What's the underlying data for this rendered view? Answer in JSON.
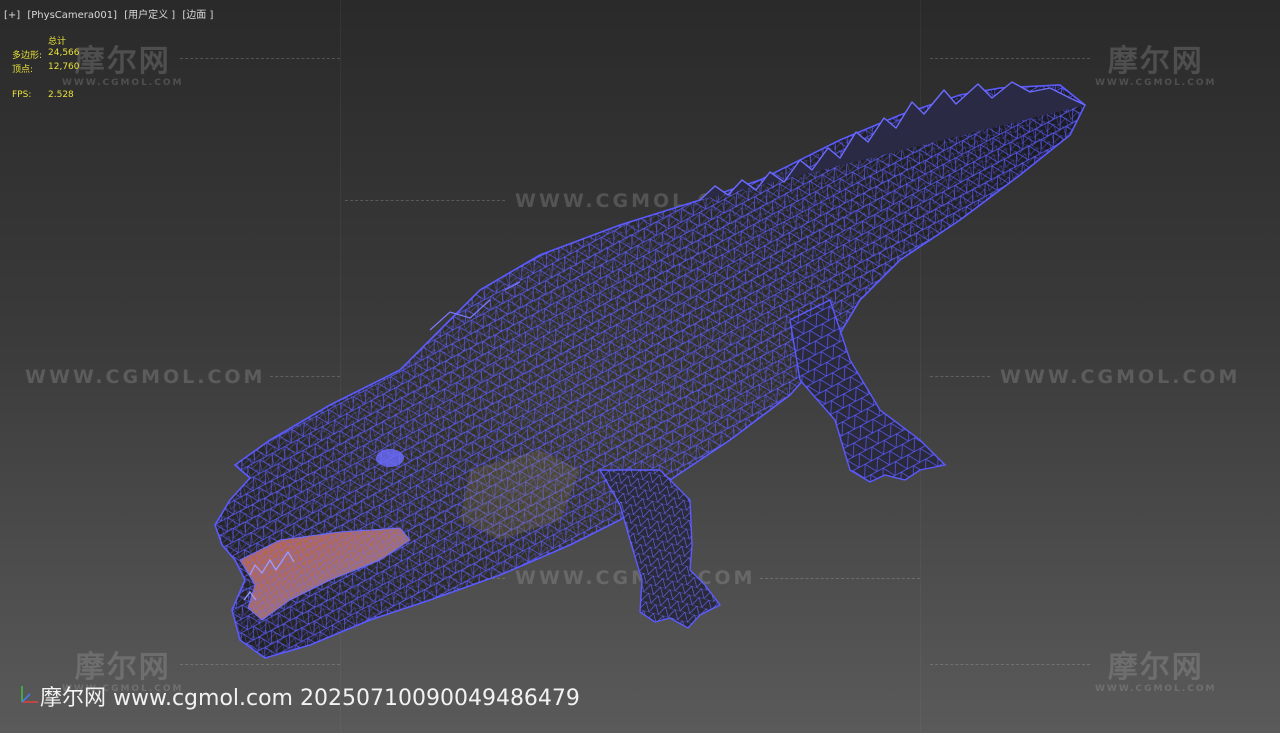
{
  "viewport": {
    "label_items": [
      "[+]",
      "[PhysCamera001]",
      "[用户定义 ]",
      "[边面 ]"
    ]
  },
  "stats": {
    "header": "总计",
    "polygons_label": "多边形:",
    "polygons_value": "24,566",
    "vertices_label": "顶点:",
    "vertices_value": "12,760",
    "fps_label": "FPS:",
    "fps_value": "2.528"
  },
  "watermarks": {
    "logo_text": "摩尔网",
    "logo_sub": "WWW.CGMOL.COM",
    "url_text": "WWW.CGMOL.COM",
    "bottom_text": "摩尔网 www.cgmol.com 20250710090049486479"
  },
  "colors": {
    "wire": "#5a5aff",
    "stats_text": "#e8e03a",
    "background_top": "#2a2a2a",
    "background_bottom": "#5a5a5a"
  },
  "model": {
    "icon": "crocodile-wireframe-model"
  }
}
